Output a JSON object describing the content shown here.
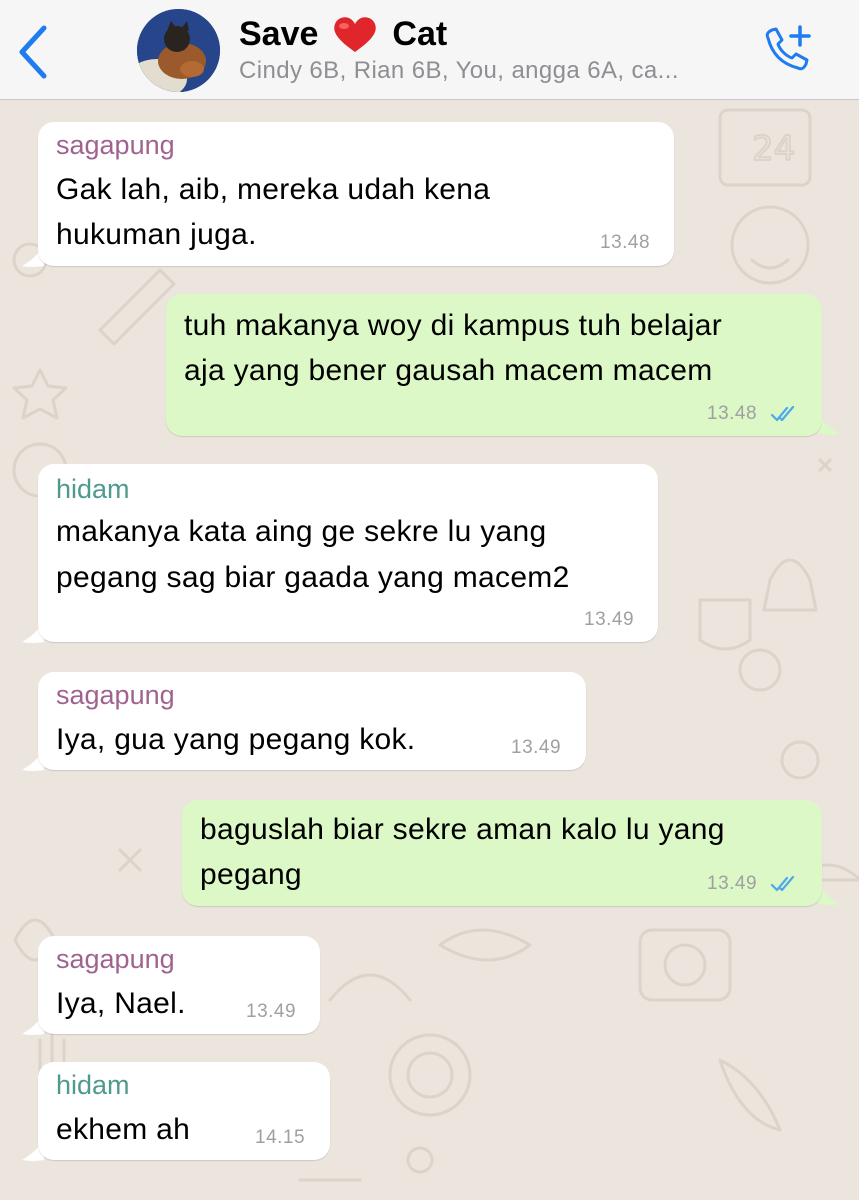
{
  "header": {
    "back_label": "",
    "title_part1": "Save",
    "title_part2": "Cat",
    "members": "Cindy 6B, Rian 6B, You, angga 6A, ca...",
    "icons": {
      "back": "chevron-left-icon",
      "add_call": "add-call-icon",
      "heart": "red-heart-emoji"
    }
  },
  "colors": {
    "accent": "#1e7cf0",
    "incoming_bubble": "#ffffff",
    "outgoing_bubble": "#dcf8c6",
    "sender_sagapung": "#a0638f",
    "sender_hidam": "#4e9a8e",
    "read_ticks": "#4fa8e8"
  },
  "messages": [
    {
      "direction": "incoming",
      "sender": "sagapung",
      "lines": [
        "Gak lah, aib, mereka udah kena",
        "hukuman juga."
      ],
      "time": "13.48"
    },
    {
      "direction": "outgoing",
      "lines": [
        "tuh makanya woy di kampus tuh belajar",
        "aja yang bener gausah macem macem"
      ],
      "time": "13.48",
      "status": "read"
    },
    {
      "direction": "incoming",
      "sender": "hidam",
      "lines": [
        "makanya kata aing ge sekre lu yang",
        "pegang sag biar gaada yang macem2"
      ],
      "time": "13.49"
    },
    {
      "direction": "incoming",
      "sender": "sagapung",
      "lines": [
        "Iya, gua yang pegang kok."
      ],
      "time": "13.49"
    },
    {
      "direction": "outgoing",
      "lines": [
        "baguslah biar sekre aman kalo lu yang",
        "pegang"
      ],
      "time": "13.49",
      "status": "read"
    },
    {
      "direction": "incoming",
      "sender": "sagapung",
      "lines": [
        "Iya, Nael."
      ],
      "time": "13.49"
    },
    {
      "direction": "incoming",
      "sender": "hidam",
      "lines": [
        "ekhem ah"
      ],
      "time": "14.15"
    }
  ]
}
